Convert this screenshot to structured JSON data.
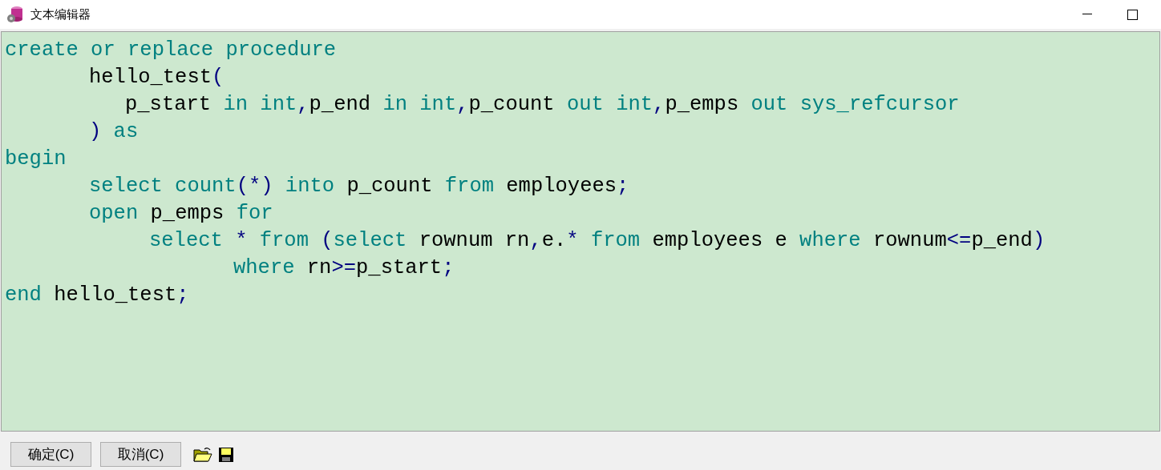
{
  "window": {
    "title": "文本编辑器"
  },
  "editor": {
    "lines": [
      {
        "tokens": [
          {
            "kind": "keyword",
            "text": "create or replace procedure"
          }
        ]
      },
      {
        "kind": "indented",
        "tokens": [
          {
            "kind": "ident",
            "text": "hello_test"
          },
          {
            "kind": "symbol",
            "text": "("
          }
        ]
      },
      {
        "kind": "param",
        "tokens": [
          {
            "kind": "ident",
            "text": "p_start"
          },
          {
            "kind": "keyword",
            "text": " in int"
          },
          {
            "kind": "symbol",
            "text": ","
          },
          {
            "kind": "ident",
            "text": "p_end"
          },
          {
            "kind": "keyword",
            "text": " in int"
          },
          {
            "kind": "symbol",
            "text": ","
          },
          {
            "kind": "ident",
            "text": "p_count"
          },
          {
            "kind": "keyword",
            "text": " out int"
          },
          {
            "kind": "symbol",
            "text": ","
          },
          {
            "kind": "ident",
            "text": "p_emps"
          },
          {
            "kind": "keyword",
            "text": " out sys_refcursor"
          }
        ]
      },
      {
        "kind": "indented",
        "tokens": [
          {
            "kind": "symbol",
            "text": ")"
          },
          {
            "kind": "keyword",
            "text": " as"
          }
        ]
      },
      {
        "tokens": [
          {
            "kind": "keyword",
            "text": "begin"
          }
        ]
      },
      {
        "kind": "indented",
        "tokens": [
          {
            "kind": "keyword",
            "text": "select count"
          },
          {
            "kind": "symbol",
            "text": "(*)"
          },
          {
            "kind": "keyword",
            "text": " into"
          },
          {
            "kind": "ident",
            "text": " p_count"
          },
          {
            "kind": "keyword",
            "text": " from"
          },
          {
            "kind": "ident",
            "text": " employees"
          },
          {
            "kind": "symbol",
            "text": ";"
          }
        ]
      },
      {
        "kind": "indented",
        "tokens": [
          {
            "kind": "keyword",
            "text": "open"
          },
          {
            "kind": "ident",
            "text": " p_emps"
          },
          {
            "kind": "keyword",
            "text": " for"
          }
        ]
      },
      {
        "kind": "nested",
        "tokens": [
          {
            "kind": "keyword",
            "text": "select"
          },
          {
            "kind": "symbol",
            "text": " *"
          },
          {
            "kind": "keyword",
            "text": " from"
          },
          {
            "kind": "symbol",
            "text": " ("
          },
          {
            "kind": "keyword",
            "text": "select"
          },
          {
            "kind": "ident",
            "text": " rownum rn"
          },
          {
            "kind": "symbol",
            "text": ","
          },
          {
            "kind": "ident",
            "text": "e."
          },
          {
            "kind": "symbol",
            "text": "*"
          },
          {
            "kind": "keyword",
            "text": " from"
          },
          {
            "kind": "ident",
            "text": " employees e"
          },
          {
            "kind": "keyword",
            "text": " where"
          },
          {
            "kind": "ident",
            "text": " rownum"
          },
          {
            "kind": "symbol",
            "text": "<="
          },
          {
            "kind": "ident",
            "text": "p_end"
          },
          {
            "kind": "symbol",
            "text": ")"
          }
        ]
      },
      {
        "kind": "continued",
        "tokens": [
          {
            "kind": "keyword",
            "text": "where"
          },
          {
            "kind": "ident",
            "text": " rn"
          },
          {
            "kind": "symbol",
            "text": ">="
          },
          {
            "kind": "ident",
            "text": "p_start"
          },
          {
            "kind": "symbol",
            "text": ";"
          }
        ]
      },
      {
        "tokens": [
          {
            "kind": "keyword",
            "text": "end"
          },
          {
            "kind": "ident",
            "text": " hello_test"
          },
          {
            "kind": "symbol",
            "text": ";"
          }
        ]
      }
    ]
  },
  "buttons": [
    {
      "label": "确定(C)"
    },
    {
      "label": "取消(C)"
    }
  ]
}
